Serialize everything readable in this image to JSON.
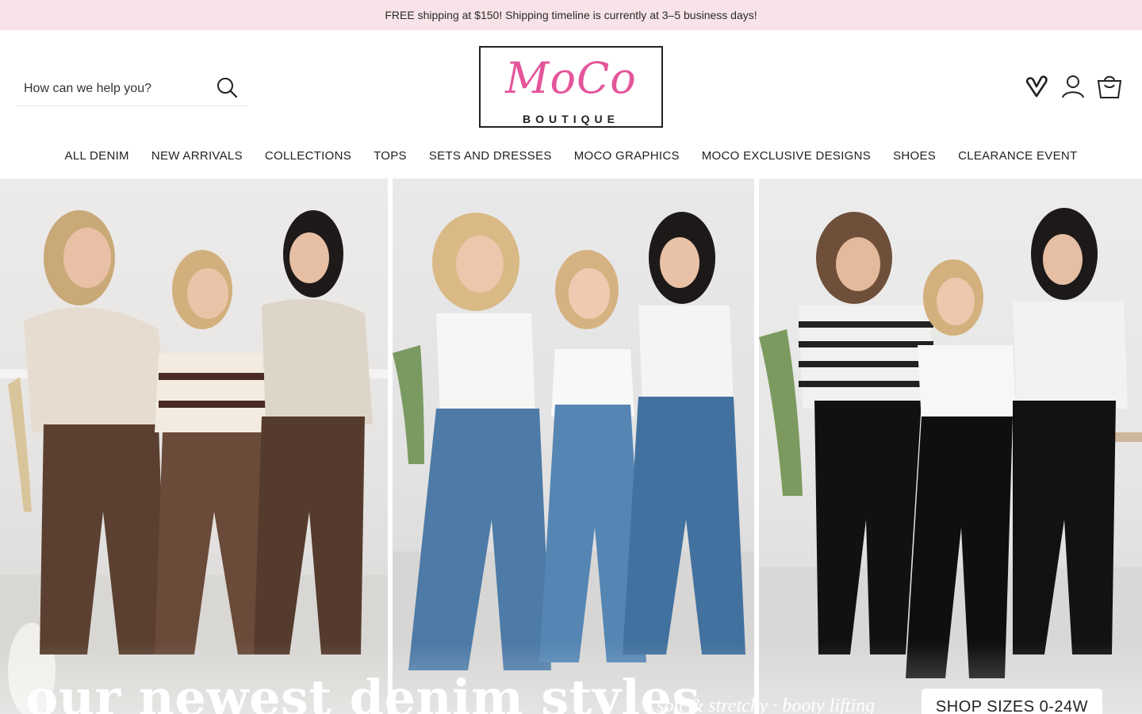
{
  "announcement": {
    "text": "FREE shipping at $150! Shipping timeline is currently at 3–5 business days!"
  },
  "search": {
    "placeholder": "How can we help you?"
  },
  "logo": {
    "script_text": "MoCo",
    "sub_text": "BOUTIQUE",
    "script_color": "#e4559a"
  },
  "header_icons": [
    {
      "name": "wishlist-heart-icon"
    },
    {
      "name": "account-icon"
    },
    {
      "name": "cart-bag-icon"
    }
  ],
  "nav": {
    "items": [
      {
        "label": "ALL DENIM"
      },
      {
        "label": "NEW ARRIVALS"
      },
      {
        "label": "COLLECTIONS"
      },
      {
        "label": "TOPS"
      },
      {
        "label": "SETS AND DRESSES"
      },
      {
        "label": "MOCO GRAPHICS"
      },
      {
        "label": "MOCO EXCLUSIVE DESIGNS"
      },
      {
        "label": "SHOES"
      },
      {
        "label": "CLEARANCE EVENT"
      }
    ]
  },
  "hero": {
    "headline": "our newest denim styles",
    "tagline": "· soft & stretchy · booty lifting",
    "cta_label": "SHOP SIZES 0-24W",
    "panels": [
      "brown-denim-group-photo",
      "blue-flare-denim-group-photo",
      "black-denim-group-photo"
    ]
  },
  "colors": {
    "announcement_bg": "#f8e4e8",
    "brand_pink": "#e4559a",
    "text": "#222222"
  }
}
